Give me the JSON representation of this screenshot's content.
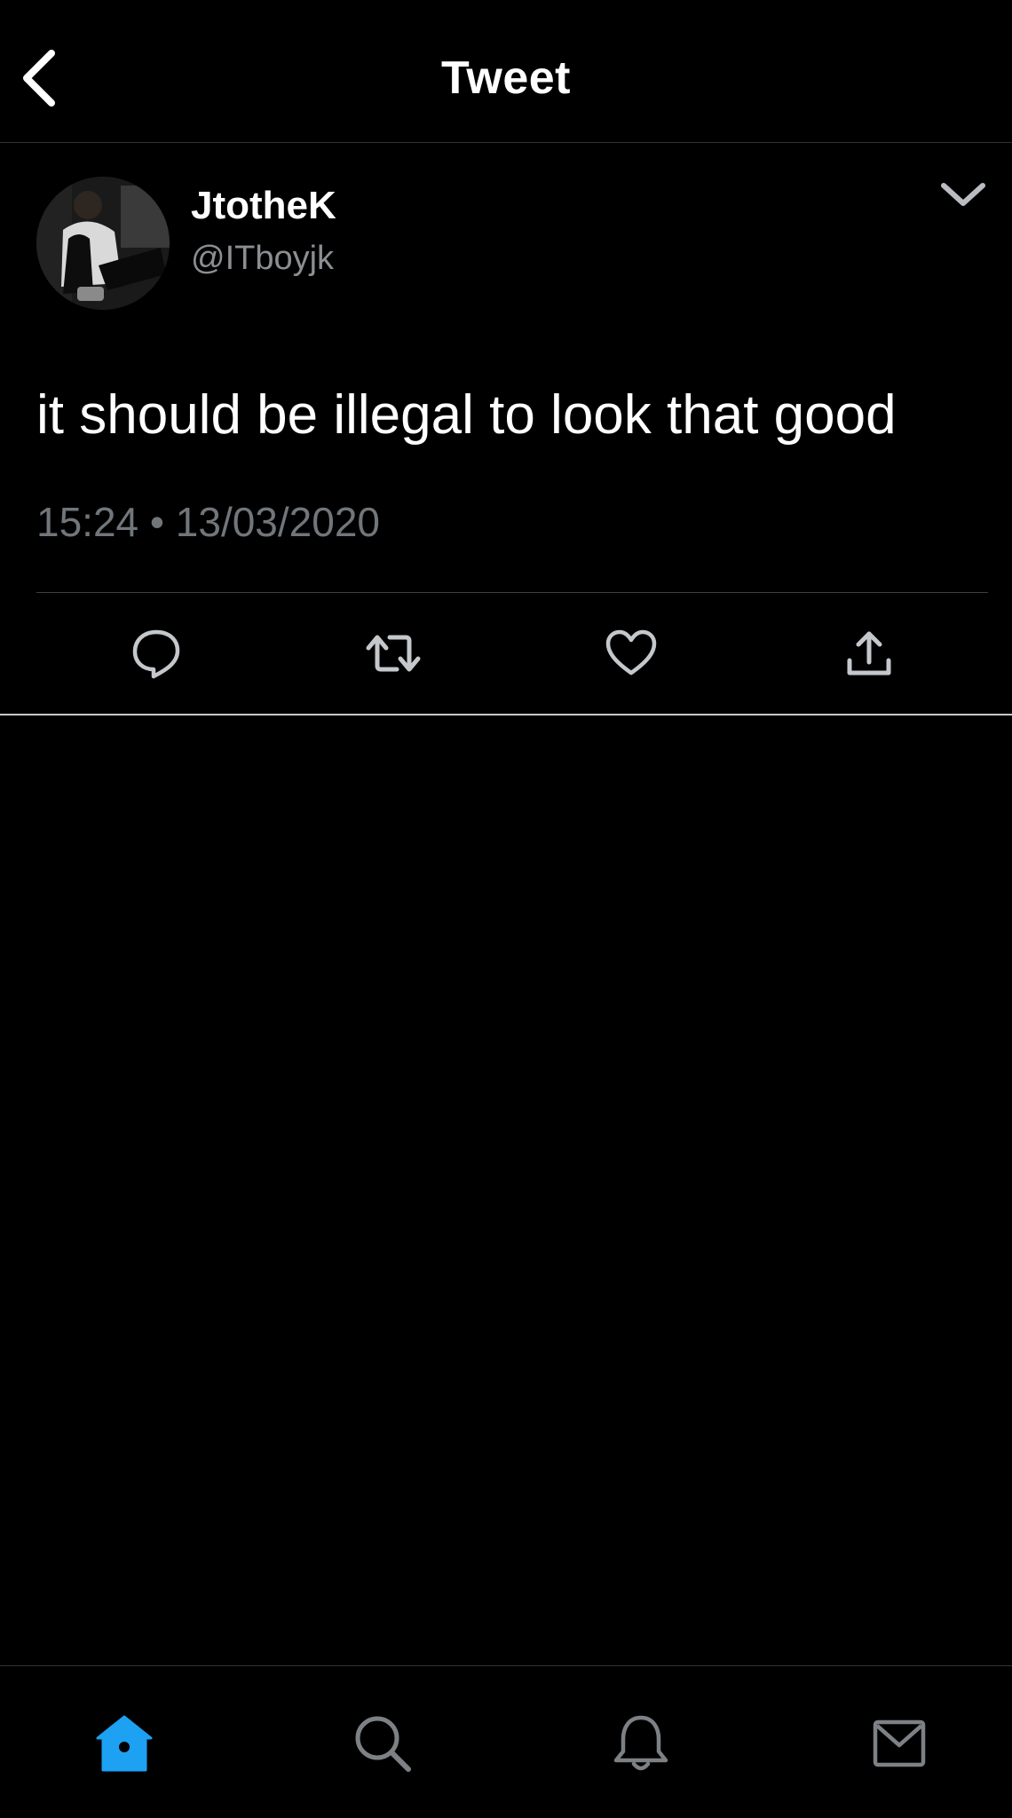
{
  "header": {
    "title": "Tweet",
    "back_icon": "back-chevron-icon"
  },
  "tweet": {
    "display_name": "JtotheK",
    "handle": "@ITboyjk",
    "text": "it should be illegal to look that good",
    "timestamp": "15:24 • 13/03/2020",
    "actions": [
      "reply-icon",
      "retweet-icon",
      "like-icon",
      "share-icon"
    ]
  },
  "tabbar": {
    "tabs": [
      "home-icon",
      "search-icon",
      "notifications-icon",
      "messages-icon"
    ],
    "active_tab": "home",
    "active_color": "#1da1f2",
    "inactive_color": "#7d8186"
  },
  "colors": {
    "background": "#000000",
    "text_primary": "#ffffff",
    "text_secondary": "#71767b"
  }
}
